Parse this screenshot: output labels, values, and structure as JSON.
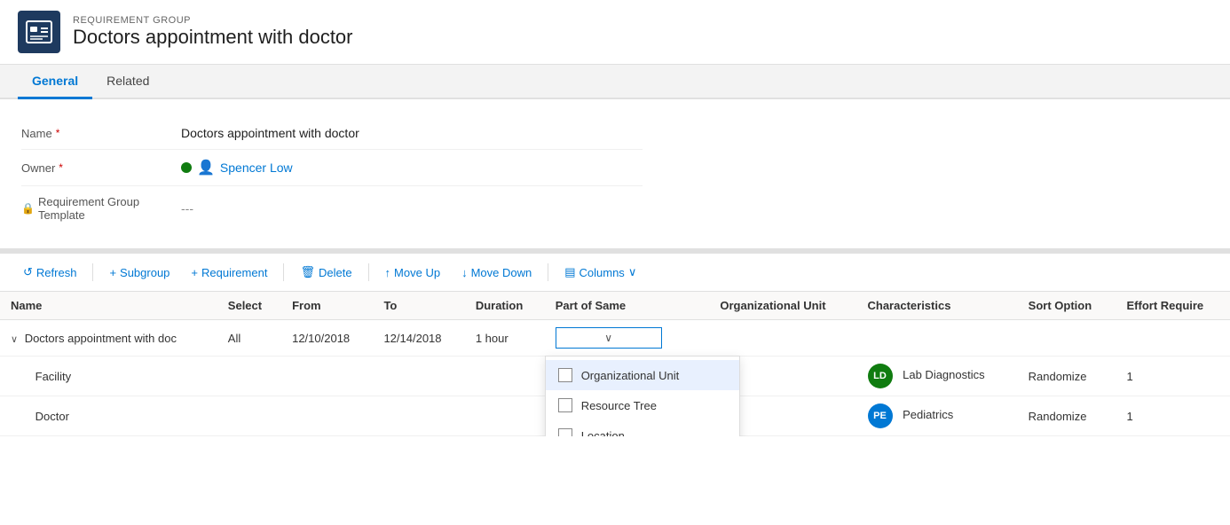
{
  "header": {
    "category": "REQUIREMENT GROUP",
    "title": "Doctors appointment with doctor"
  },
  "tabs": [
    {
      "id": "general",
      "label": "General",
      "active": true
    },
    {
      "id": "related",
      "label": "Related",
      "active": false
    }
  ],
  "form": {
    "fields": [
      {
        "id": "name",
        "label": "Name",
        "required": true,
        "value": "Doctors appointment with doctor",
        "type": "text"
      },
      {
        "id": "owner",
        "label": "Owner",
        "required": true,
        "value": "Spencer Low",
        "type": "link"
      },
      {
        "id": "template",
        "label": "Requirement Group Template",
        "required": false,
        "value": "---",
        "type": "locked"
      }
    ]
  },
  "toolbar": {
    "buttons": [
      {
        "id": "refresh",
        "label": "Refresh",
        "icon": "↺",
        "disabled": false
      },
      {
        "id": "subgroup",
        "label": "Subgroup",
        "icon": "+",
        "disabled": false
      },
      {
        "id": "requirement",
        "label": "Requirement",
        "icon": "+",
        "disabled": false
      },
      {
        "id": "delete",
        "label": "Delete",
        "icon": "🗑",
        "disabled": false
      },
      {
        "id": "move-up",
        "label": "Move Up",
        "icon": "↑",
        "disabled": false
      },
      {
        "id": "move-down",
        "label": "Move Down",
        "icon": "↓",
        "disabled": false
      },
      {
        "id": "columns",
        "label": "Columns",
        "icon": "▼",
        "disabled": false
      }
    ]
  },
  "table": {
    "columns": [
      {
        "id": "name",
        "label": "Name"
      },
      {
        "id": "select",
        "label": "Select"
      },
      {
        "id": "from",
        "label": "From"
      },
      {
        "id": "to",
        "label": "To"
      },
      {
        "id": "duration",
        "label": "Duration"
      },
      {
        "id": "part-of-same",
        "label": "Part of Same"
      },
      {
        "id": "org-unit",
        "label": "Organizational Unit"
      },
      {
        "id": "characteristics",
        "label": "Characteristics"
      },
      {
        "id": "sort-option",
        "label": "Sort Option"
      },
      {
        "id": "effort-required",
        "label": "Effort Require"
      }
    ],
    "rows": [
      {
        "id": "parent",
        "name": "Doctors appointment with doc",
        "select": "All",
        "from": "12/10/2018",
        "to": "12/14/2018",
        "duration": "1 hour",
        "part-of-same": "",
        "dropdown-open": true,
        "org-unit": "",
        "characteristics": "",
        "sort-option": "",
        "effort-required": "",
        "indent": 0,
        "expandable": true
      },
      {
        "id": "facility",
        "name": "Facility",
        "select": "",
        "from": "",
        "to": "",
        "duration": "",
        "part-of-same": "",
        "org-unit": "",
        "avatar": "LD",
        "avatar-class": "avatar-ld",
        "characteristics": "Lab Diagnostics",
        "sort-option": "Randomize",
        "effort-required": "1",
        "indent": 1
      },
      {
        "id": "doctor",
        "name": "Doctor",
        "select": "",
        "from": "",
        "to": "",
        "duration": "",
        "part-of-same": "",
        "org-unit": "",
        "avatar": "PE",
        "avatar-class": "avatar-pe",
        "characteristics": "Pediatrics",
        "sort-option": "Randomize",
        "effort-required": "1",
        "indent": 1
      }
    ],
    "dropdown": {
      "options": [
        {
          "id": "org-unit",
          "label": "Organizational Unit",
          "checked": false
        },
        {
          "id": "resource-tree",
          "label": "Resource Tree",
          "checked": false
        },
        {
          "id": "location",
          "label": "Location",
          "checked": false
        }
      ]
    }
  }
}
